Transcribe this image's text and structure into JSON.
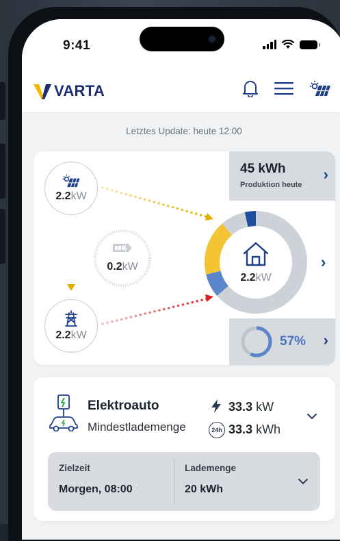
{
  "status": {
    "time": "9:41"
  },
  "header": {
    "brand": "VARTA"
  },
  "last_update": "Letztes Update: heute 12:00",
  "flow": {
    "solar": {
      "value": "2.2",
      "unit": "kW"
    },
    "battery": {
      "value": "0.2",
      "unit": "kW"
    },
    "grid": {
      "value": "2.2",
      "unit": "kW"
    },
    "house": {
      "value": "2.2",
      "unit": "kW"
    },
    "production": {
      "value": "45 kWh",
      "label": "Produktion heute"
    },
    "autarky": {
      "value": "57%",
      "fraction": 0.57
    }
  },
  "ev": {
    "title": "Elektroauto",
    "mode": "Mindestlademenge",
    "power": {
      "value": "33.3",
      "unit": "kW"
    },
    "energy": {
      "value": "33.3",
      "unit": "kWh"
    },
    "energy_badge": "24h",
    "target_time": {
      "label": "Zielzeit",
      "value": "Morgen, 08:00"
    },
    "charge_amount": {
      "label": "Lademenge",
      "value": "20 kWh"
    }
  },
  "colors": {
    "navy": "#1d4f9e",
    "yellow": "#f5c432",
    "blue": "#5b86cc",
    "grey": "#cdd2d8",
    "red": "#e23a3a"
  }
}
